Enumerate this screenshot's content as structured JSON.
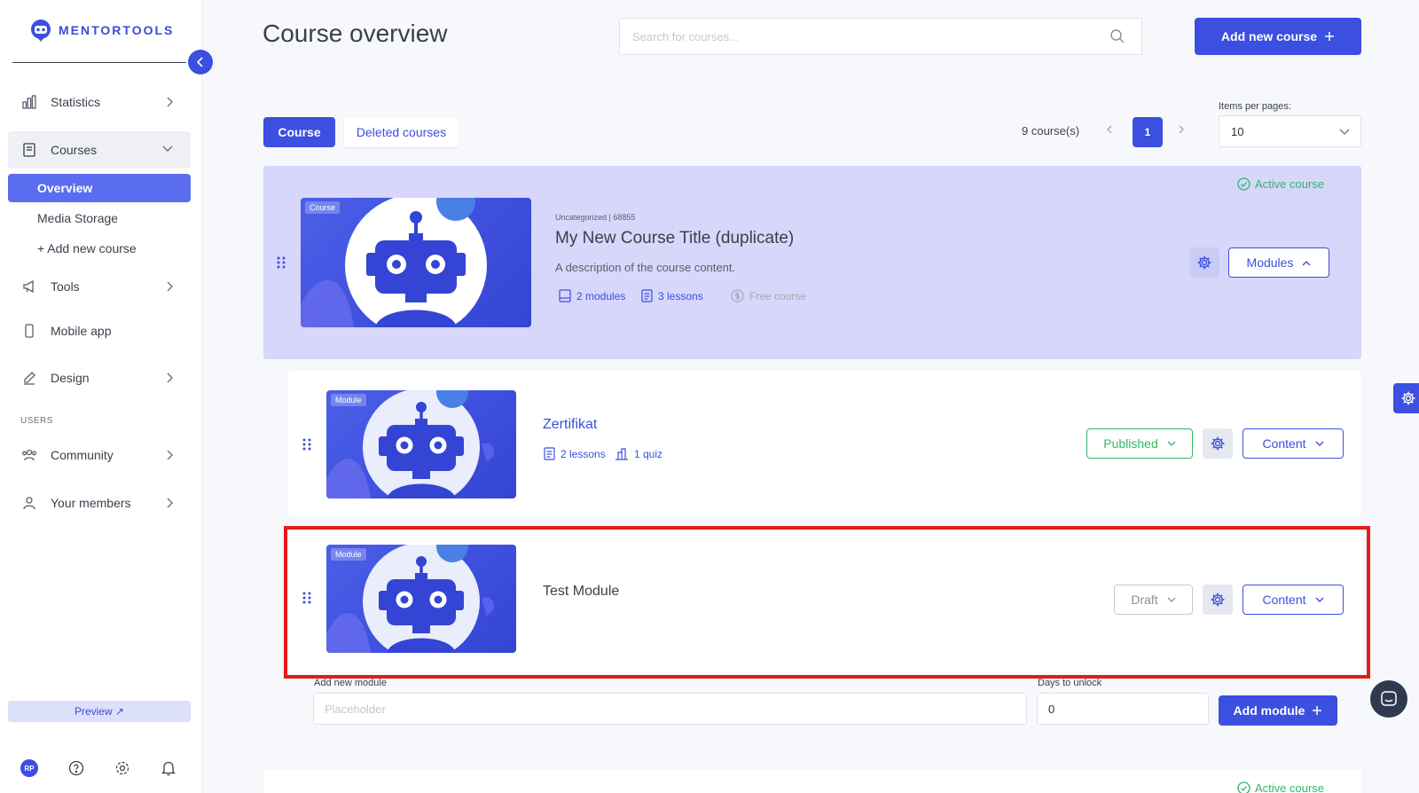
{
  "brand": {
    "name": "MENTORTOOLS",
    "accent": "#3b4fe0"
  },
  "sidebar": {
    "items": [
      {
        "label": "Statistics",
        "icon": "bar-chart-icon"
      },
      {
        "label": "Courses",
        "icon": "book-icon"
      },
      {
        "label": "Tools",
        "icon": "megaphone-icon"
      },
      {
        "label": "Mobile app",
        "icon": "smartphone-icon"
      },
      {
        "label": "Design",
        "icon": "pencil-icon"
      },
      {
        "label": "Community",
        "icon": "users-icon"
      },
      {
        "label": "Your members",
        "icon": "user-icon"
      }
    ],
    "courses_sub": [
      "Overview",
      "Media Storage",
      "+ Add new course"
    ],
    "section_users": "USERS",
    "preview_label": "Preview ↗",
    "avatar_initials": "RP"
  },
  "header": {
    "title": "Course overview",
    "search_placeholder": "Search for courses...",
    "add_course_label": "Add new course"
  },
  "toolbar": {
    "tab_course": "Course",
    "tab_deleted": "Deleted courses",
    "count": "9 course(s)",
    "current_page": "1",
    "items_per_page_label": "Items per pages:",
    "items_per_page_value": "10"
  },
  "course": {
    "thumb_tag": "Course",
    "active_label": "Active course",
    "meta": "Uncategorized | 68855",
    "title": "My New Course Title (duplicate)",
    "description": "A description of the course content.",
    "modules_count": "2 modules",
    "lessons_count": "3 lessons",
    "price": "Free course",
    "modules_button": "Modules"
  },
  "modules": [
    {
      "tag": "Module",
      "title": "Zertifikat",
      "lessons": "2 lessons",
      "quiz": "1 quiz",
      "status": "Published",
      "content_button": "Content"
    },
    {
      "tag": "Module",
      "title": "Test Module",
      "status": "Draft",
      "content_button": "Content"
    }
  ],
  "add_module": {
    "name_label": "Add new module",
    "name_placeholder": "Placeholder",
    "days_label": "Days to unlock",
    "days_value": "0",
    "button_label": "Add module"
  },
  "next_course": {
    "active_label": "Active course"
  }
}
